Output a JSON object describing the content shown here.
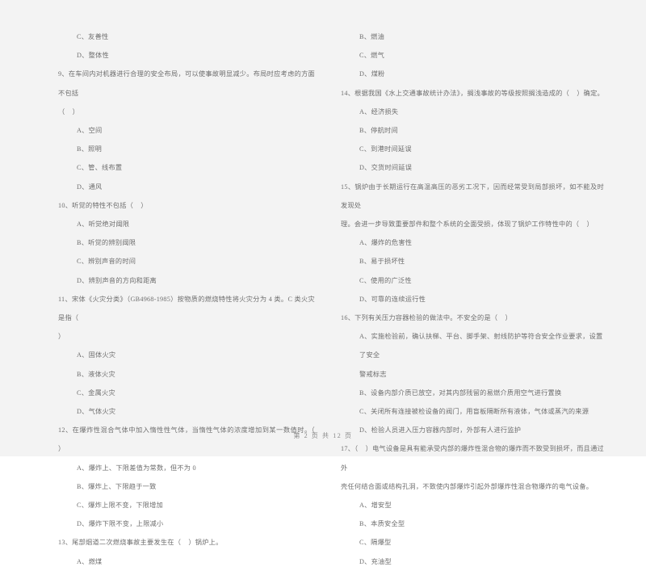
{
  "document": {
    "kind": "scanned-exam-paper",
    "language": "zh-CN",
    "footer": "第 2 页 共 12 页"
  },
  "left_column": {
    "blocks": [
      {
        "type": "option",
        "text": "C、友善性"
      },
      {
        "type": "option",
        "text": "D、整体性"
      },
      {
        "type": "question",
        "text": "9、在车间内对机器进行合理的安全布局，可以使事故明显减少。布局时应考虑的方面不包括"
      },
      {
        "type": "question_wrap",
        "text": "（    ）"
      },
      {
        "type": "option",
        "text": "A、空间"
      },
      {
        "type": "option",
        "text": "B、照明"
      },
      {
        "type": "option",
        "text": "C、管、线布置"
      },
      {
        "type": "option",
        "text": "D、通风"
      },
      {
        "type": "question",
        "text": "10、听觉的特性不包括（    ）"
      },
      {
        "type": "option",
        "text": "A、听觉绝对阈限"
      },
      {
        "type": "option",
        "text": "B、听觉的辨别阈限"
      },
      {
        "type": "option",
        "text": "C、辨别声音的时间"
      },
      {
        "type": "option",
        "text": "D、辨别声音的方向和距离"
      },
      {
        "type": "question",
        "text": "11、宋体《火灾分类》（GB4968-1985）按物质的燃烧特性将火灾分为 4 类。C 类火灾是指（"
      },
      {
        "type": "question_wrap",
        "text": "）"
      },
      {
        "type": "option",
        "text": "A、固体火灾"
      },
      {
        "type": "option",
        "text": "B、液体火灾"
      },
      {
        "type": "option",
        "text": "C、金属火灾"
      },
      {
        "type": "option",
        "text": "D、气体火灾"
      },
      {
        "type": "question",
        "text": "12、在爆炸性混合气体中加入惰性性气体，当惰性气体的浓度增加到某一数值时。（    ）"
      },
      {
        "type": "option",
        "text": "A、爆炸上、下限差值为常数，但不为 0"
      },
      {
        "type": "option",
        "text": "B、爆炸上、下限趋于一致"
      },
      {
        "type": "option",
        "text": "C、爆炸上限不变，下限增加"
      },
      {
        "type": "option",
        "text": "D、爆炸下限不变，上限减小"
      },
      {
        "type": "question",
        "text": "13、尾部烟道二次燃烧事故主要发生在（    ）锅炉上。"
      },
      {
        "type": "option",
        "text": "A、燃煤"
      }
    ]
  },
  "right_column": {
    "blocks": [
      {
        "type": "option",
        "text": "B、燃油"
      },
      {
        "type": "option",
        "text": "C、燃气"
      },
      {
        "type": "option",
        "text": "D、煤粉"
      },
      {
        "type": "question",
        "text": "14、根据我国《水上交通事故统计办法》，搁浅事故的等级按照搁浅造成的（    ）确定。"
      },
      {
        "type": "option",
        "text": "A、经济损失"
      },
      {
        "type": "option",
        "text": "B、停航时间"
      },
      {
        "type": "option",
        "text": "C、到港时间延误"
      },
      {
        "type": "option",
        "text": "D、交货时间延误"
      },
      {
        "type": "question",
        "text": "15、锅炉由于长期运行在高温高压的恶劣工况下，因而经常受到局部损坏，如不能及时发现处"
      },
      {
        "type": "question_wrap",
        "text": "理。会进一步导致重要部件和整个系统的全面受损，体现了锅炉工作特性中的（    ）"
      },
      {
        "type": "option",
        "text": "A、爆炸的危害性"
      },
      {
        "type": "option",
        "text": "B、易于损坏性"
      },
      {
        "type": "option",
        "text": "C、使用的广泛性"
      },
      {
        "type": "option",
        "text": "D、可靠的连续运行性"
      },
      {
        "type": "question",
        "text": "16、下列有关压力容器检验的做法中。不安全的是（    ）"
      },
      {
        "type": "option",
        "text": "A、实施检验前，确认扶梯、平台、脚手架、射线防护等符合安全作业要求，设置了安全"
      },
      {
        "type": "option_wrap",
        "text": "警戒标志"
      },
      {
        "type": "option",
        "text": "B、设备内部介质已放空，对其内部残留的易燃介质用空气进行置换"
      },
      {
        "type": "option",
        "text": "C、关闭所有连接被检设备的阀门，用盲板隔断所有液体，气体或蒸汽的来源"
      },
      {
        "type": "option",
        "text": "D、检验人员进入压力容器内部时，外部有人进行监护"
      },
      {
        "type": "question",
        "text": "17、（    ）电气设备是具有能承受内部的爆炸性混合物的爆炸而不致受到损坏，而且通过外"
      },
      {
        "type": "question_wrap",
        "text": "壳任何结合面或结构孔洞，不致使内部爆炸引起外部爆炸性混合物爆炸的电气设备。"
      },
      {
        "type": "option",
        "text": "A、增安型"
      },
      {
        "type": "option",
        "text": "B、本质安全型"
      },
      {
        "type": "option",
        "text": "C、隔爆型"
      },
      {
        "type": "option",
        "text": "D、充油型"
      }
    ]
  }
}
